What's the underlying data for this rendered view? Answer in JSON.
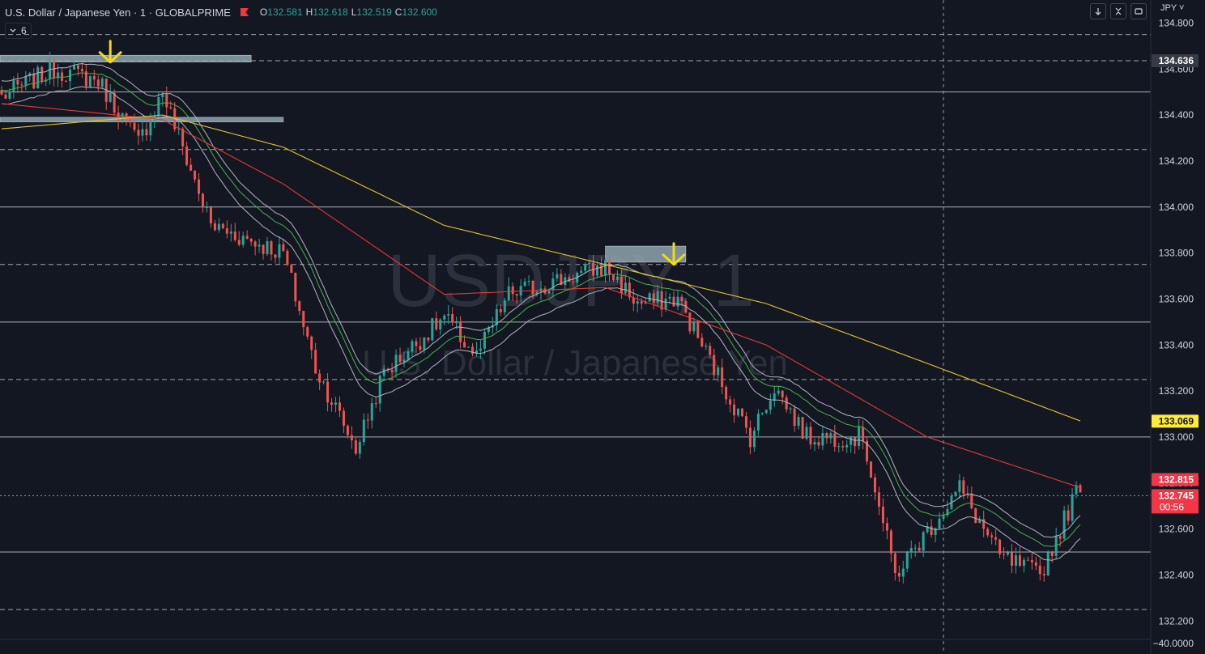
{
  "header": {
    "title": "U.S. Dollar / Japanese Yen · 1 · GLOBALPRIME",
    "ohlc": [
      {
        "key": "O",
        "value": "132.581"
      },
      {
        "key": "H",
        "value": "132.618"
      },
      {
        "key": "L",
        "value": "132.519"
      },
      {
        "key": "C",
        "value": "132.600"
      }
    ]
  },
  "indicators": {
    "count": "6",
    "toggle_icon": "chevron-down-icon"
  },
  "toolbar": {
    "currency": "JPY"
  },
  "watermark": {
    "symbol": "USDJPY, 1",
    "description": "U.S. Dollar / Japanese Yen"
  },
  "colors": {
    "background": "#131722",
    "up": "#26a69a",
    "down": "#ef5350",
    "ema_red": "#e53935",
    "ema_yellow": "#e5c42a",
    "band": "#b2b5be",
    "band_mid": "#4caf50",
    "zone": "#8fa5ad",
    "arrow": "#f5d90a"
  },
  "chart_data": {
    "type": "candlestick",
    "symbol": "USDJPY",
    "timeframe": "1",
    "y_axis": {
      "ticks": [
        "134.800",
        "134.600",
        "134.400",
        "134.200",
        "134.000",
        "133.800",
        "133.600",
        "133.400",
        "133.200",
        "133.000",
        "132.800",
        "132.600",
        "132.400",
        "132.200",
        "−40.0000"
      ],
      "range": [
        132.12,
        134.9
      ]
    },
    "price_labels": [
      {
        "value": "134.636",
        "style": "dark"
      },
      {
        "value": "133.069",
        "style": "yellow"
      },
      {
        "value": "132.815",
        "style": "red"
      },
      {
        "value": "132.745",
        "sub": "00:56",
        "style": "red"
      }
    ],
    "horizontal_levels": [
      {
        "price": 134.75,
        "style": "dashed"
      },
      {
        "price": 134.636,
        "style": "dashed"
      },
      {
        "price": 134.5,
        "style": "solid"
      },
      {
        "price": 134.25,
        "style": "dashed"
      },
      {
        "price": 134.0,
        "style": "solid"
      },
      {
        "price": 133.75,
        "style": "dashed"
      },
      {
        "price": 133.5,
        "style": "solid"
      },
      {
        "price": 133.25,
        "style": "dashed"
      },
      {
        "price": 133.0,
        "style": "solid"
      },
      {
        "price": 132.745,
        "style": "dotted"
      },
      {
        "price": 132.5,
        "style": "solid"
      },
      {
        "price": 132.25,
        "style": "dashed"
      }
    ],
    "zones": [
      {
        "from_bar": -5,
        "to_bar": 62,
        "top": 134.66,
        "bottom": 134.63
      },
      {
        "from_bar": -5,
        "to_bar": 70,
        "top": 134.39,
        "bottom": 134.37
      },
      {
        "from_bar": 150,
        "to_bar": 170,
        "top": 133.83,
        "bottom": 133.76
      }
    ],
    "arrows": [
      {
        "bar": 27,
        "price": 134.63
      },
      {
        "bar": 167,
        "price": 133.75
      }
    ],
    "crosshair_bar": 234,
    "path_bars": [
      0,
      13,
      24,
      34,
      40,
      52,
      70,
      78,
      88,
      95,
      110,
      118,
      126,
      150,
      158,
      168,
      186,
      192,
      200,
      214,
      222,
      238,
      248,
      258,
      268
    ],
    "path_closes": [
      134.48,
      134.6,
      134.55,
      134.28,
      134.5,
      133.92,
      133.8,
      133.3,
      132.95,
      133.28,
      133.52,
      133.35,
      133.62,
      133.74,
      133.58,
      133.6,
      133.0,
      133.22,
      133.0,
      133.0,
      132.4,
      132.78,
      132.48,
      132.4,
      132.8
    ],
    "bar_count": 269,
    "series": [
      {
        "name": "EMA red",
        "color": "#e53935",
        "bars": [
          0,
          40,
          70,
          110,
          150,
          190,
          230,
          268
        ],
        "values": [
          134.45,
          134.38,
          134.1,
          133.62,
          133.65,
          133.4,
          133.0,
          132.78
        ]
      },
      {
        "name": "EMA yellow",
        "color": "#e5c42a",
        "bars": [
          0,
          40,
          70,
          110,
          150,
          190,
          230,
          268
        ],
        "values": [
          134.34,
          134.4,
          134.26,
          133.92,
          133.75,
          133.58,
          133.32,
          133.07
        ]
      }
    ]
  }
}
